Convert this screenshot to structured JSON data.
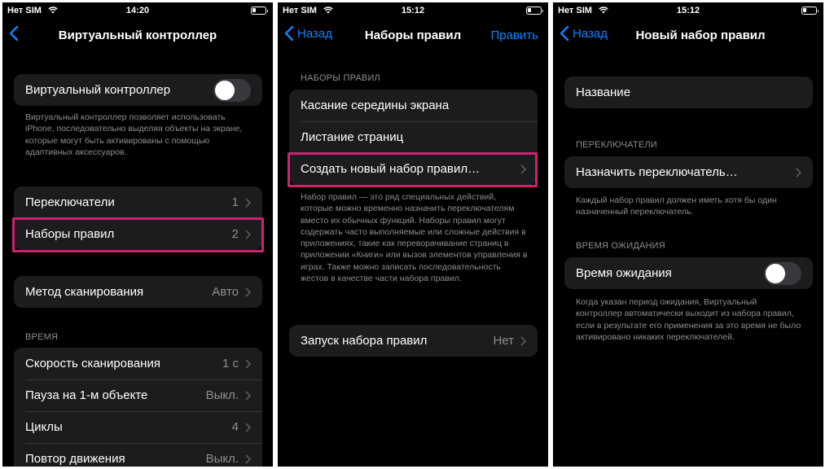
{
  "colors": {
    "accent": "#0a84ff",
    "highlight": "#d1206f",
    "background": "#000000",
    "cell": "#1c1c1e"
  },
  "panel1": {
    "status": {
      "carrier": "Нет SIM",
      "time": "14:20"
    },
    "nav": {
      "title": "Виртуальный контроллер",
      "back_icon": "chevron-left-icon"
    },
    "toggle_row": {
      "label": "Виртуальный контроллер",
      "on": false
    },
    "toggle_footer": "Виртуальный контроллер позволяет использовать iPhone, последовательно выделяя объекты на экране, которые могут быть активированы с помощью адаптивных аксессуаров.",
    "switches": {
      "label": "Переключатели",
      "value": "1"
    },
    "recipes": {
      "label": "Наборы правил",
      "value": "2"
    },
    "scan_method": {
      "label": "Метод сканирования",
      "value": "Авто"
    },
    "time_header": "ВРЕМЯ",
    "time_rows": [
      {
        "label": "Скорость сканирования",
        "value": "1 с"
      },
      {
        "label": "Пауза на 1-м объекте",
        "value": "Выкл."
      },
      {
        "label": "Циклы",
        "value": "4"
      },
      {
        "label": "Повтор движения",
        "value": "Выкл."
      }
    ]
  },
  "panel2": {
    "status": {
      "carrier": "Нет SIM",
      "time": "15:12"
    },
    "nav": {
      "back": "Назад",
      "title": "Наборы правил",
      "edit": "Править"
    },
    "section_header": "НАБОРЫ ПРАВИЛ",
    "rules": [
      "Касание середины экрана",
      "Листание страниц"
    ],
    "create": "Создать новый набор правил…",
    "footer": "Набор правил — это ряд специальных действий, которые можно временно назначить переключателям вместо их обычных функций. Наборы правил могут содержать часто выполняемые или сложные действия в приложениях, такие как переворачивание страниц в приложении «Книги» или вызов элементов управления в играх. Также можно записать последовательность жестов в качестве части набора правил.",
    "launch": {
      "label": "Запуск набора правил",
      "value": "Нет"
    }
  },
  "panel3": {
    "status": {
      "carrier": "Нет SIM",
      "time": "15:12"
    },
    "nav": {
      "back": "Назад",
      "title": "Новый набор правил"
    },
    "name_label": "Название",
    "switches_header": "ПЕРЕКЛЮЧАТЕЛИ",
    "assign": "Назначить переключатель…",
    "assign_footer": "Каждый набор правил должен иметь хотя бы один назначенный переключатель.",
    "timeout_header": "ВРЕМЯ ОЖИДАНИЯ",
    "timeout_row": {
      "label": "Время ожидания",
      "on": false
    },
    "timeout_footer": "Когда указан период ожидания, Виртуальный контроллер автоматически выходит из набора правил, если в результате его применения за это время не было активировано никаких переключателей."
  }
}
